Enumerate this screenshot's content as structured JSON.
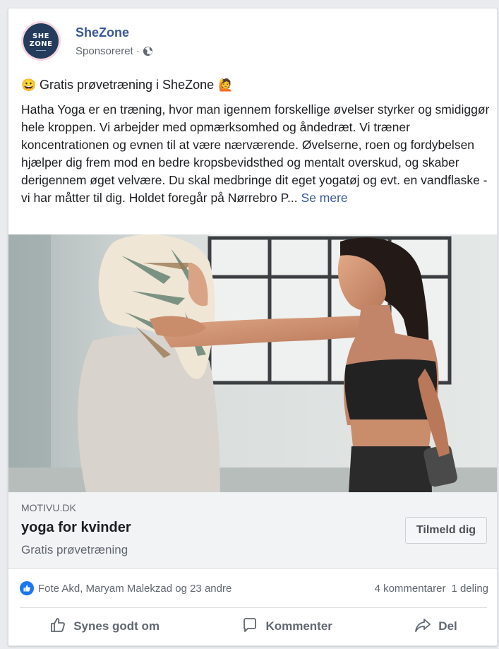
{
  "post": {
    "page_name": "SheZone",
    "sponsored_label": "Sponsoreret ·",
    "avatar_line1": "SHE",
    "avatar_line2": "ZONE",
    "headline_emoji_start": "😀",
    "headline": "Gratis prøvetræning i SheZone",
    "headline_emoji_end": "🙋",
    "body": "Hatha Yoga er en træning, hvor man igennem forskellige øvelser styrker og smidiggør hele kroppen. Vi arbejder med opmærksomhed og åndedræt. Vi træner koncentrationen og evnen til at være nærværende. Øvelserne, roen og fordybelsen hjælper dig frem mod en bedre kropsbevidsthed og mentalt overskud, og skaber derigennem øget velvære. Du skal medbringe dit eget yogatøj og evt. en vandflaske - vi har måtter til dig. Holdet foregår på Nørrebro P...",
    "see_more": "Se mere"
  },
  "link_preview": {
    "domain": "MOTIVU.DK",
    "title": "yoga for kvinder",
    "description": "Gratis prøvetræning",
    "cta": "Tilmeld dig"
  },
  "reactions": {
    "names": "Fote Akd, Maryam Malekzad og 23 andre",
    "comments": "4 kommentarer",
    "shares": "1 deling"
  },
  "actions": {
    "like": "Synes godt om",
    "comment": "Kommenter",
    "share": "Del"
  },
  "colors": {
    "link_blue": "#385898",
    "like_blue": "#1877f2",
    "avatar_navy": "#243b5c"
  },
  "icons": [
    "globe-icon",
    "like-reaction-icon",
    "thumbs-up-icon",
    "comment-icon",
    "share-icon"
  ]
}
